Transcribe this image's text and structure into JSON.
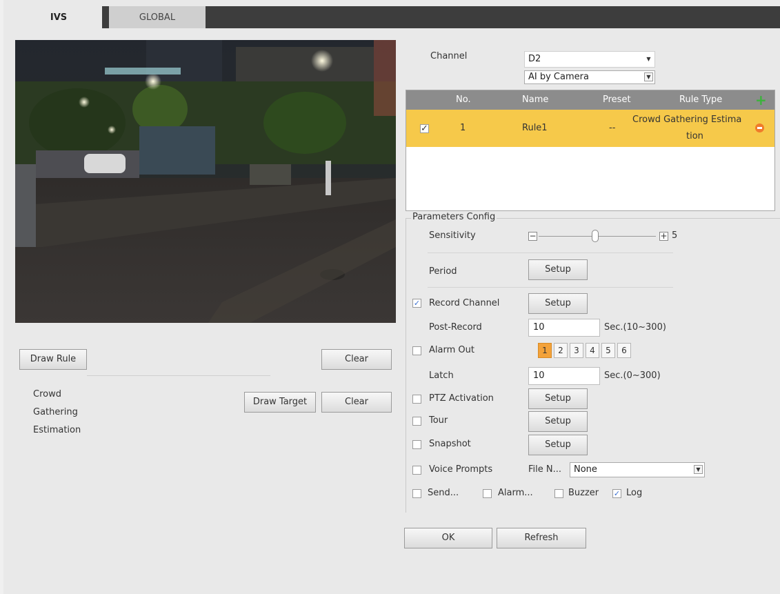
{
  "tabs": [
    {
      "label": "IVS"
    },
    {
      "label": "GLOBAL"
    }
  ],
  "left": {
    "draw_rule": "Draw Rule",
    "clear1": "Clear",
    "rule_type_lines": [
      "Crowd",
      "Gathering",
      "Estimation"
    ],
    "draw_target": "Draw Target",
    "clear2": "Clear"
  },
  "channel": {
    "label": "Channel",
    "value": "D2",
    "mode": "AI by Camera"
  },
  "table": {
    "headers": {
      "no": "No.",
      "name": "Name",
      "preset": "Preset",
      "rule_type": "Rule Type"
    },
    "rows": [
      {
        "no": "1",
        "name": "Rule1",
        "preset": "--",
        "rule_type_1": "Crowd Gathering Estima",
        "rule_type_2": "tion",
        "checked": true
      }
    ]
  },
  "params": {
    "title": "Parameters Config",
    "sensitivity": {
      "label": "Sensitivity",
      "minus": "−",
      "plus": "+",
      "value": "5",
      "level_fraction": 0.5
    },
    "period": {
      "label": "Period",
      "button": "Setup"
    },
    "record_channel": {
      "label": "Record Channel",
      "button": "Setup",
      "checked": true
    },
    "post_record": {
      "label": "Post-Record",
      "value": "10",
      "unit": "Sec.(10~300)"
    },
    "alarm_out": {
      "label": "Alarm Out",
      "checked": false,
      "outputs": [
        "1",
        "2",
        "3",
        "4",
        "5",
        "6"
      ],
      "selected": "1"
    },
    "latch": {
      "label": "Latch",
      "value": "10",
      "unit": "Sec.(0~300)"
    },
    "ptz": {
      "label": "PTZ Activation",
      "button": "Setup",
      "checked": false
    },
    "tour": {
      "label": "Tour",
      "button": "Setup",
      "checked": false
    },
    "snapshot": {
      "label": "Snapshot",
      "button": "Setup",
      "checked": false
    },
    "voice": {
      "label": "Voice Prompts",
      "file_label": "File N...",
      "file_value": "None",
      "checked": false
    },
    "send": {
      "label": "Send...",
      "checked": false
    },
    "alarm": {
      "label": "Alarm...",
      "checked": false
    },
    "buzzer": {
      "label": "Buzzer",
      "checked": false
    },
    "log": {
      "label": "Log",
      "checked": true
    }
  },
  "footer": {
    "ok": "OK",
    "refresh": "Refresh"
  },
  "colors": {
    "selected_row": "#f6c94a",
    "header": "#8c8c8c",
    "add": "#3bb33b",
    "remove": "#f07b2a",
    "selected_output": "#f3a23a"
  },
  "icons": {
    "add": "plus-icon",
    "remove": "minus-circle-icon",
    "checkbox": "check-icon",
    "dropdown": "chevron-down-icon"
  }
}
